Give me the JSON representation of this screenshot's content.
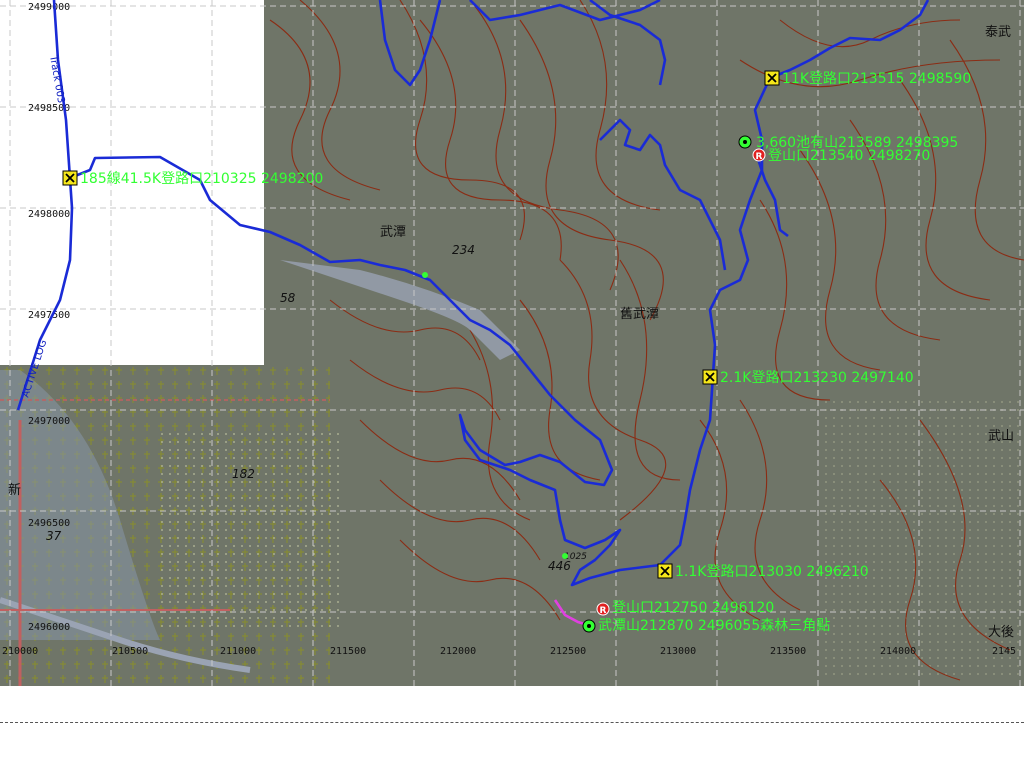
{
  "colors": {
    "terrain": "#6f7568",
    "contour": "#8b2c14",
    "grid": "#c8c8c8",
    "track": "#1a2bd6",
    "waypoint_label": "#33ff33",
    "waypoint_box": "#f5e61a",
    "river": "#9aa3b3",
    "road": "#c06060",
    "alt_track": "#e040e0"
  },
  "grid": {
    "eastings": [
      "210000",
      "210500",
      "211000",
      "211500",
      "212000",
      "212500",
      "213000",
      "213500",
      "214000"
    ],
    "northings": [
      "2499000",
      "2498500",
      "2498000",
      "2497500",
      "2497000",
      "2496500",
      "2496000"
    ],
    "partial_easting_label": "2145"
  },
  "track_labels": [
    "Track 003",
    "ACTIVE LOG"
  ],
  "waypoints": [
    {
      "id": "wp1",
      "icon": "x-box-icon",
      "label": "185線41.5K登路口210325 2498200"
    },
    {
      "id": "wp2",
      "icon": "x-box-icon",
      "label": "11K登路口213515 2498590"
    },
    {
      "id": "wp3",
      "icon": "target-icon",
      "label": "3,660池有山213589 2498395"
    },
    {
      "id": "wp4",
      "icon": "rest-icon",
      "label": "登山口213540 2498270"
    },
    {
      "id": "wp5",
      "icon": "x-box-icon",
      "label": "2.1K登路口213230 2497140"
    },
    {
      "id": "wp6",
      "icon": "x-box-icon",
      "label": "1.1K登路口213030 2496210"
    },
    {
      "id": "wp7",
      "icon": "rest-icon",
      "label": "登山口212750 2496120"
    },
    {
      "id": "wp8",
      "icon": "target-icon",
      "label": "武潭山212870 2496055森林三角點"
    }
  ],
  "places": {
    "village1": "武潭",
    "village2": "舊武潭",
    "village3": "泰武",
    "village4": "武山",
    "village5": "大後",
    "road_label": "新"
  },
  "elevations": [
    "234",
    "182",
    "58",
    "37",
    "446",
    "1025"
  ],
  "rest_symbol": "R"
}
